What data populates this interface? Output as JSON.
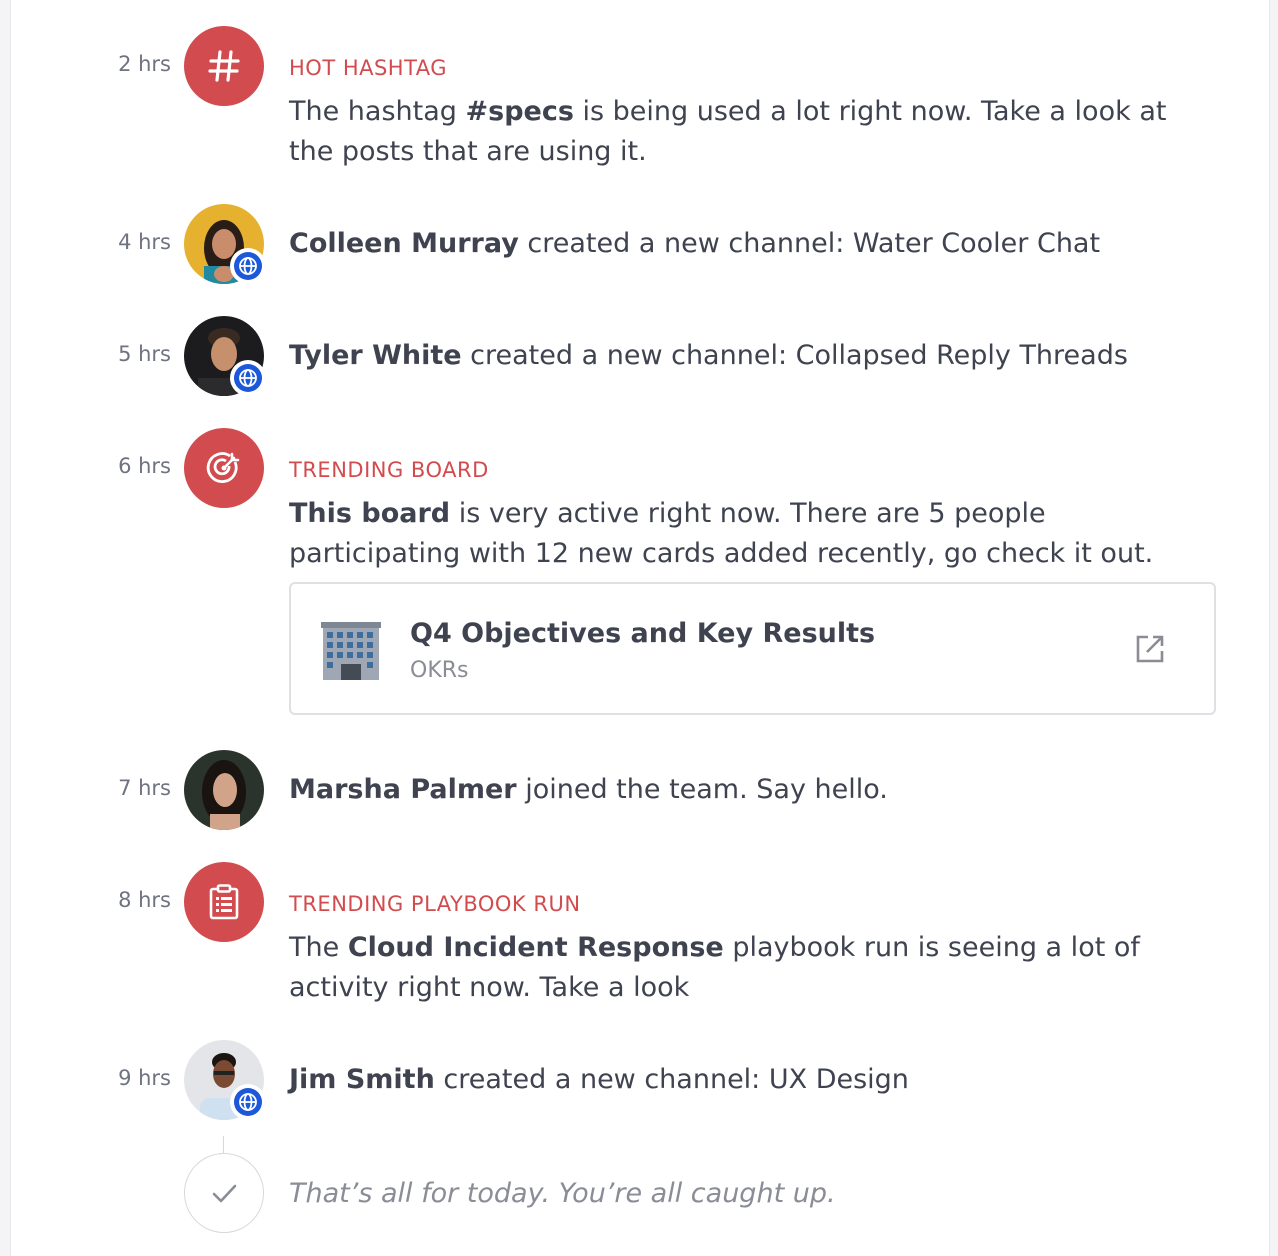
{
  "feed": {
    "items": [
      {
        "time": "2 hrs",
        "label": "HOT HASHTAG",
        "text_pre": "The hashtag ",
        "bold": "#specs",
        "text_post": " is being used a lot right now. Take a look at the posts that are using it.",
        "icon": "hashtag-icon"
      },
      {
        "time": "4 hrs",
        "name": "Colleen Murray",
        "text": " created a new channel: Water Cooler Chat",
        "icon": "globe-icon"
      },
      {
        "time": "5 hrs",
        "name": "Tyler White",
        "text": " created a new channel: Collapsed Reply Threads",
        "icon": "globe-icon"
      },
      {
        "time": "6 hrs",
        "label": "TRENDING BOARD",
        "bold": "This board",
        "text_post": " is very active right now. There are 5 people participating with 12 new cards added recently, go check it out.",
        "icon": "target-icon",
        "card": {
          "title": "Q4 Objectives and Key Results",
          "subtitle": "OKRs",
          "emoji": "office-building-icon",
          "action_icon": "open-external-icon"
        }
      },
      {
        "time": "7 hrs",
        "name": "Marsha Palmer",
        "text": " joined the team. Say hello."
      },
      {
        "time": "8 hrs",
        "label": "TRENDING PLAYBOOK RUN",
        "text_pre": "The ",
        "bold": "Cloud Incident Response",
        "text_post": " playbook run is seeing a lot of activity right now. Take a look",
        "icon": "clipboard-icon"
      },
      {
        "time": "9 hrs",
        "name": "Jim Smith",
        "text": " created a new channel: UX Design",
        "icon": "globe-icon"
      }
    ],
    "done_text": "That’s all for today. You’re all caught up."
  },
  "colors": {
    "accent": "#d24b4e",
    "text": "#3f4350",
    "muted": "#8a8c96",
    "badge": "#1c58d9"
  }
}
